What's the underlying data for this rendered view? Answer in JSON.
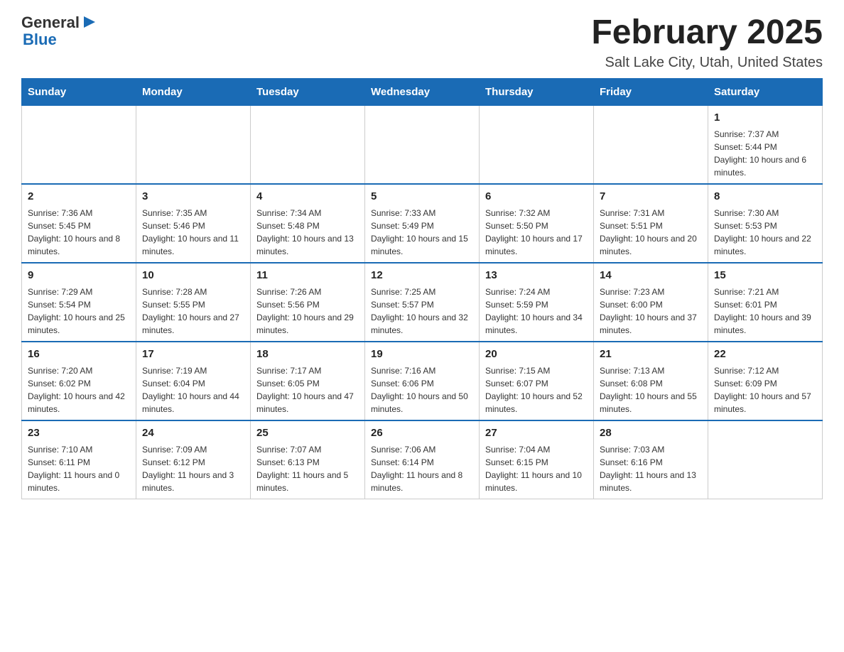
{
  "header": {
    "logo_general": "General",
    "logo_blue": "Blue",
    "title": "February 2025",
    "subtitle": "Salt Lake City, Utah, United States"
  },
  "days_of_week": [
    "Sunday",
    "Monday",
    "Tuesday",
    "Wednesday",
    "Thursday",
    "Friday",
    "Saturday"
  ],
  "weeks": [
    [
      {
        "day": "",
        "info": ""
      },
      {
        "day": "",
        "info": ""
      },
      {
        "day": "",
        "info": ""
      },
      {
        "day": "",
        "info": ""
      },
      {
        "day": "",
        "info": ""
      },
      {
        "day": "",
        "info": ""
      },
      {
        "day": "1",
        "info": "Sunrise: 7:37 AM\nSunset: 5:44 PM\nDaylight: 10 hours and 6 minutes."
      }
    ],
    [
      {
        "day": "2",
        "info": "Sunrise: 7:36 AM\nSunset: 5:45 PM\nDaylight: 10 hours and 8 minutes."
      },
      {
        "day": "3",
        "info": "Sunrise: 7:35 AM\nSunset: 5:46 PM\nDaylight: 10 hours and 11 minutes."
      },
      {
        "day": "4",
        "info": "Sunrise: 7:34 AM\nSunset: 5:48 PM\nDaylight: 10 hours and 13 minutes."
      },
      {
        "day": "5",
        "info": "Sunrise: 7:33 AM\nSunset: 5:49 PM\nDaylight: 10 hours and 15 minutes."
      },
      {
        "day": "6",
        "info": "Sunrise: 7:32 AM\nSunset: 5:50 PM\nDaylight: 10 hours and 17 minutes."
      },
      {
        "day": "7",
        "info": "Sunrise: 7:31 AM\nSunset: 5:51 PM\nDaylight: 10 hours and 20 minutes."
      },
      {
        "day": "8",
        "info": "Sunrise: 7:30 AM\nSunset: 5:53 PM\nDaylight: 10 hours and 22 minutes."
      }
    ],
    [
      {
        "day": "9",
        "info": "Sunrise: 7:29 AM\nSunset: 5:54 PM\nDaylight: 10 hours and 25 minutes."
      },
      {
        "day": "10",
        "info": "Sunrise: 7:28 AM\nSunset: 5:55 PM\nDaylight: 10 hours and 27 minutes."
      },
      {
        "day": "11",
        "info": "Sunrise: 7:26 AM\nSunset: 5:56 PM\nDaylight: 10 hours and 29 minutes."
      },
      {
        "day": "12",
        "info": "Sunrise: 7:25 AM\nSunset: 5:57 PM\nDaylight: 10 hours and 32 minutes."
      },
      {
        "day": "13",
        "info": "Sunrise: 7:24 AM\nSunset: 5:59 PM\nDaylight: 10 hours and 34 minutes."
      },
      {
        "day": "14",
        "info": "Sunrise: 7:23 AM\nSunset: 6:00 PM\nDaylight: 10 hours and 37 minutes."
      },
      {
        "day": "15",
        "info": "Sunrise: 7:21 AM\nSunset: 6:01 PM\nDaylight: 10 hours and 39 minutes."
      }
    ],
    [
      {
        "day": "16",
        "info": "Sunrise: 7:20 AM\nSunset: 6:02 PM\nDaylight: 10 hours and 42 minutes."
      },
      {
        "day": "17",
        "info": "Sunrise: 7:19 AM\nSunset: 6:04 PM\nDaylight: 10 hours and 44 minutes."
      },
      {
        "day": "18",
        "info": "Sunrise: 7:17 AM\nSunset: 6:05 PM\nDaylight: 10 hours and 47 minutes."
      },
      {
        "day": "19",
        "info": "Sunrise: 7:16 AM\nSunset: 6:06 PM\nDaylight: 10 hours and 50 minutes."
      },
      {
        "day": "20",
        "info": "Sunrise: 7:15 AM\nSunset: 6:07 PM\nDaylight: 10 hours and 52 minutes."
      },
      {
        "day": "21",
        "info": "Sunrise: 7:13 AM\nSunset: 6:08 PM\nDaylight: 10 hours and 55 minutes."
      },
      {
        "day": "22",
        "info": "Sunrise: 7:12 AM\nSunset: 6:09 PM\nDaylight: 10 hours and 57 minutes."
      }
    ],
    [
      {
        "day": "23",
        "info": "Sunrise: 7:10 AM\nSunset: 6:11 PM\nDaylight: 11 hours and 0 minutes."
      },
      {
        "day": "24",
        "info": "Sunrise: 7:09 AM\nSunset: 6:12 PM\nDaylight: 11 hours and 3 minutes."
      },
      {
        "day": "25",
        "info": "Sunrise: 7:07 AM\nSunset: 6:13 PM\nDaylight: 11 hours and 5 minutes."
      },
      {
        "day": "26",
        "info": "Sunrise: 7:06 AM\nSunset: 6:14 PM\nDaylight: 11 hours and 8 minutes."
      },
      {
        "day": "27",
        "info": "Sunrise: 7:04 AM\nSunset: 6:15 PM\nDaylight: 11 hours and 10 minutes."
      },
      {
        "day": "28",
        "info": "Sunrise: 7:03 AM\nSunset: 6:16 PM\nDaylight: 11 hours and 13 minutes."
      },
      {
        "day": "",
        "info": ""
      }
    ]
  ]
}
